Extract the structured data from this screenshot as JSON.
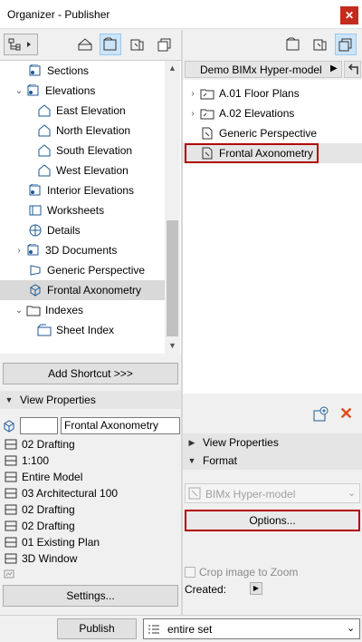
{
  "window": {
    "title": "Organizer - Publisher",
    "close_glyph": "✕"
  },
  "left_panel": {
    "tree": [
      {
        "label": "Sections",
        "indent": 1,
        "expander": "",
        "icon": "section-icon"
      },
      {
        "label": "Elevations",
        "indent": 0,
        "expander": "⌄",
        "icon": "elevation-icon"
      },
      {
        "label": "East Elevation",
        "indent": 2,
        "expander": "",
        "icon": "elevation-view-icon"
      },
      {
        "label": "North Elevation",
        "indent": 2,
        "expander": "",
        "icon": "elevation-view-icon"
      },
      {
        "label": "South Elevation",
        "indent": 2,
        "expander": "",
        "icon": "elevation-view-icon"
      },
      {
        "label": "West Elevation",
        "indent": 2,
        "expander": "",
        "icon": "elevation-view-icon"
      },
      {
        "label": "Interior Elevations",
        "indent": 1,
        "expander": "",
        "icon": "interior-elevation-icon"
      },
      {
        "label": "Worksheets",
        "indent": 1,
        "expander": "",
        "icon": "worksheet-icon"
      },
      {
        "label": "Details",
        "indent": 1,
        "expander": "",
        "icon": "detail-icon"
      },
      {
        "label": "3D Documents",
        "indent": 0,
        "expander": "›",
        "icon": "3d-document-icon"
      },
      {
        "label": "Generic Perspective",
        "indent": 1,
        "expander": "",
        "icon": "perspective-icon"
      },
      {
        "label": "Frontal Axonometry",
        "indent": 1,
        "expander": "",
        "icon": "axonometry-icon",
        "selected": true
      },
      {
        "label": "Indexes",
        "indent": 0,
        "expander": "⌄",
        "icon": "folder-icon"
      },
      {
        "label": "Sheet Index",
        "indent": 2,
        "expander": "",
        "icon": "sheet-index-icon"
      }
    ],
    "add_shortcut_label": "Add Shortcut >>>",
    "view_properties_label": "View Properties",
    "id_value": "",
    "name_value": "Frontal Axonometry",
    "properties": [
      {
        "label": "02 Drafting",
        "icon": "layer-icon"
      },
      {
        "label": "1:100",
        "icon": "scale-icon"
      },
      {
        "label": "Entire Model",
        "icon": "structure-icon"
      },
      {
        "label": "03 Architectural 100",
        "icon": "pen-set-icon"
      },
      {
        "label": "02 Drafting",
        "icon": "mvo-icon"
      },
      {
        "label": "02 Drafting",
        "icon": "graphic-override-icon"
      },
      {
        "label": "01 Existing Plan",
        "icon": "renovation-icon"
      },
      {
        "label": "3D Window",
        "icon": "3d-window-icon"
      }
    ],
    "settings_label": "Settings..."
  },
  "right_panel": {
    "publisher_set": "Demo BIMx Hyper-model",
    "tree": [
      {
        "label": "A.01 Floor Plans",
        "expander": "›",
        "icon": "folder-shortcut-icon"
      },
      {
        "label": "A.02 Elevations",
        "expander": "›",
        "icon": "folder-shortcut-icon"
      },
      {
        "label": "Generic Perspective",
        "expander": "",
        "icon": "document-icon"
      },
      {
        "label": "Frontal Axonometry",
        "expander": "",
        "icon": "document-icon",
        "selected": true
      }
    ],
    "view_properties_label": "View Properties",
    "format_label": "Format",
    "format_value": "BIMx Hyper-model",
    "options_label": "Options...",
    "crop_label": "Crop image to Zoom",
    "created_label": "Created:"
  },
  "bottom": {
    "publish_label": "Publish",
    "publish_set_value": "entire set"
  },
  "colors": {
    "accent_red": "#b00000",
    "selection_blue": "#cce4f7",
    "icon_blue": "#1e5a96"
  }
}
